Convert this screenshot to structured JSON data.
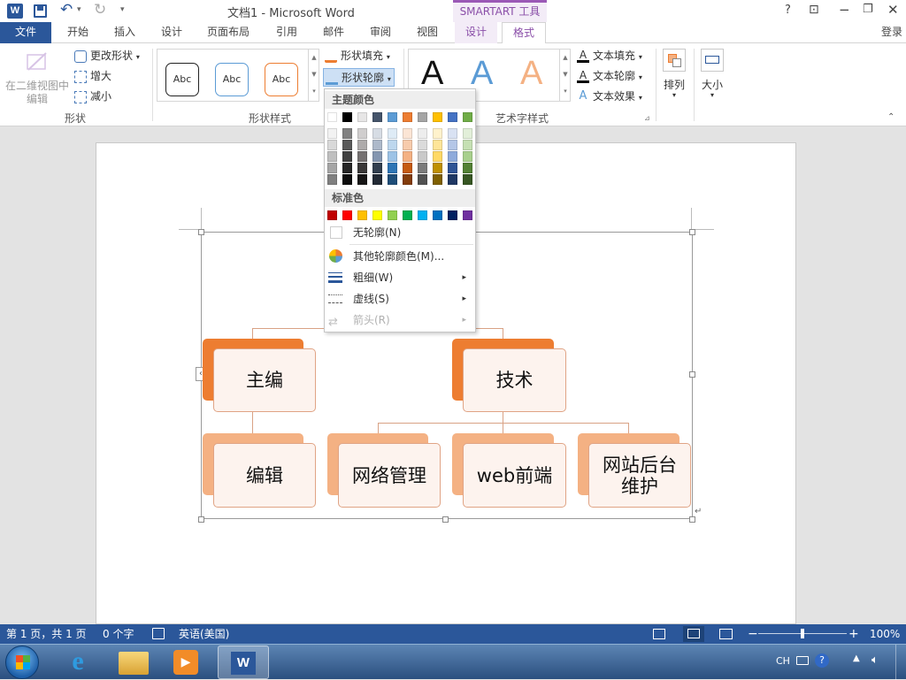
{
  "window": {
    "title": "文档1 - Microsoft Word",
    "context_tab_group": "SMARTART 工具",
    "help": "?",
    "restore_ribbon": "⊡",
    "minimize": "−",
    "maximize": "❐",
    "close": "✕"
  },
  "qat": {
    "undo_arrow": "▾",
    "customize": "▾"
  },
  "tabs": {
    "file": "文件",
    "home": "开始",
    "insert": "插入",
    "design": "设计",
    "layout": "页面布局",
    "references": "引用",
    "mailings": "邮件",
    "review": "审阅",
    "view": "视图",
    "smartart_design": "设计",
    "format": "格式",
    "signin": "登录"
  },
  "ribbon": {
    "shapes_group": {
      "edit_in_2d_line1": "在二维视图中",
      "edit_in_2d_line2": "编辑",
      "change_shape": "更改形状",
      "larger": "增大",
      "smaller": "减小",
      "label": "形状"
    },
    "shape_styles_group": {
      "style_sample": "Abc",
      "shape_fill": "形状填充",
      "shape_outline": "形状轮廓",
      "label": "形状样式"
    },
    "wordart_group": {
      "sample": "A",
      "text_fill": "文本填充",
      "text_outline": "文本轮廓",
      "text_effects": "文本效果",
      "label": "艺术字样式"
    },
    "arrange": "排列",
    "size": "大小"
  },
  "outline_menu": {
    "theme_colors_header": "主题颜色",
    "standard_colors_header": "标准色",
    "no_outline": "无轮廓(N)",
    "more_colors": "其他轮廓颜色(M)...",
    "weight": "粗细(W)",
    "dashes": "虚线(S)",
    "arrows": "箭头(R)",
    "submenu_arrow": "▸",
    "theme_top_row": [
      "#ffffff",
      "#000000",
      "#e7e6e6",
      "#44546a",
      "#5b9bd5",
      "#ed7d31",
      "#a5a5a5",
      "#ffc000",
      "#4472c4",
      "#70ad47"
    ],
    "theme_shades": [
      [
        "#f2f2f2",
        "#d9d9d9",
        "#bfbfbf",
        "#a6a6a6",
        "#808080"
      ],
      [
        "#808080",
        "#595959",
        "#404040",
        "#262626",
        "#0d0d0d"
      ],
      [
        "#d0cece",
        "#aeabab",
        "#757171",
        "#3a3838",
        "#171616"
      ],
      [
        "#d6dce4",
        "#adb9ca",
        "#8496b0",
        "#323f4f",
        "#222a35"
      ],
      [
        "#deebf6",
        "#bdd7ee",
        "#9dc3e6",
        "#2e75b5",
        "#1f4e79"
      ],
      [
        "#fbe5d5",
        "#f7cbac",
        "#f4b183",
        "#c55a11",
        "#833c0b"
      ],
      [
        "#ededed",
        "#dbdbdb",
        "#c9c9c9",
        "#7b7b7b",
        "#525252"
      ],
      [
        "#fff2cc",
        "#fee599",
        "#ffd965",
        "#bf9000",
        "#7f6000"
      ],
      [
        "#d9e2f3",
        "#b4c6e7",
        "#8eaadb",
        "#2f5496",
        "#1f3864"
      ],
      [
        "#e2efd9",
        "#c5e0b3",
        "#a8d08d",
        "#538135",
        "#375623"
      ]
    ],
    "standard_colors": [
      "#c00000",
      "#ff0000",
      "#ffc000",
      "#ffff00",
      "#92d050",
      "#00b050",
      "#00b0f0",
      "#0070c0",
      "#002060",
      "#7030a0"
    ]
  },
  "smartart": {
    "top_left": "主编",
    "top_right": "技术",
    "child1": "编辑",
    "child2": "网络管理",
    "child3": "web前端",
    "child4_line1": "网站后台",
    "child4_line2": "维护",
    "accent_dark": "#ed7d31",
    "accent_light": "#f4b183",
    "pane_toggle": "‹"
  },
  "status": {
    "page": "第 1 页，共 1 页",
    "words": "0 个字",
    "language": "英语(美国)",
    "zoom_minus": "−",
    "zoom_plus": "+",
    "zoom": "100%",
    "zoom_level": 1.0
  },
  "taskbar": {
    "ime": "CH"
  },
  "colors": {
    "word_blue": "#2b579a",
    "smartart_purple": "#9b59b6"
  }
}
